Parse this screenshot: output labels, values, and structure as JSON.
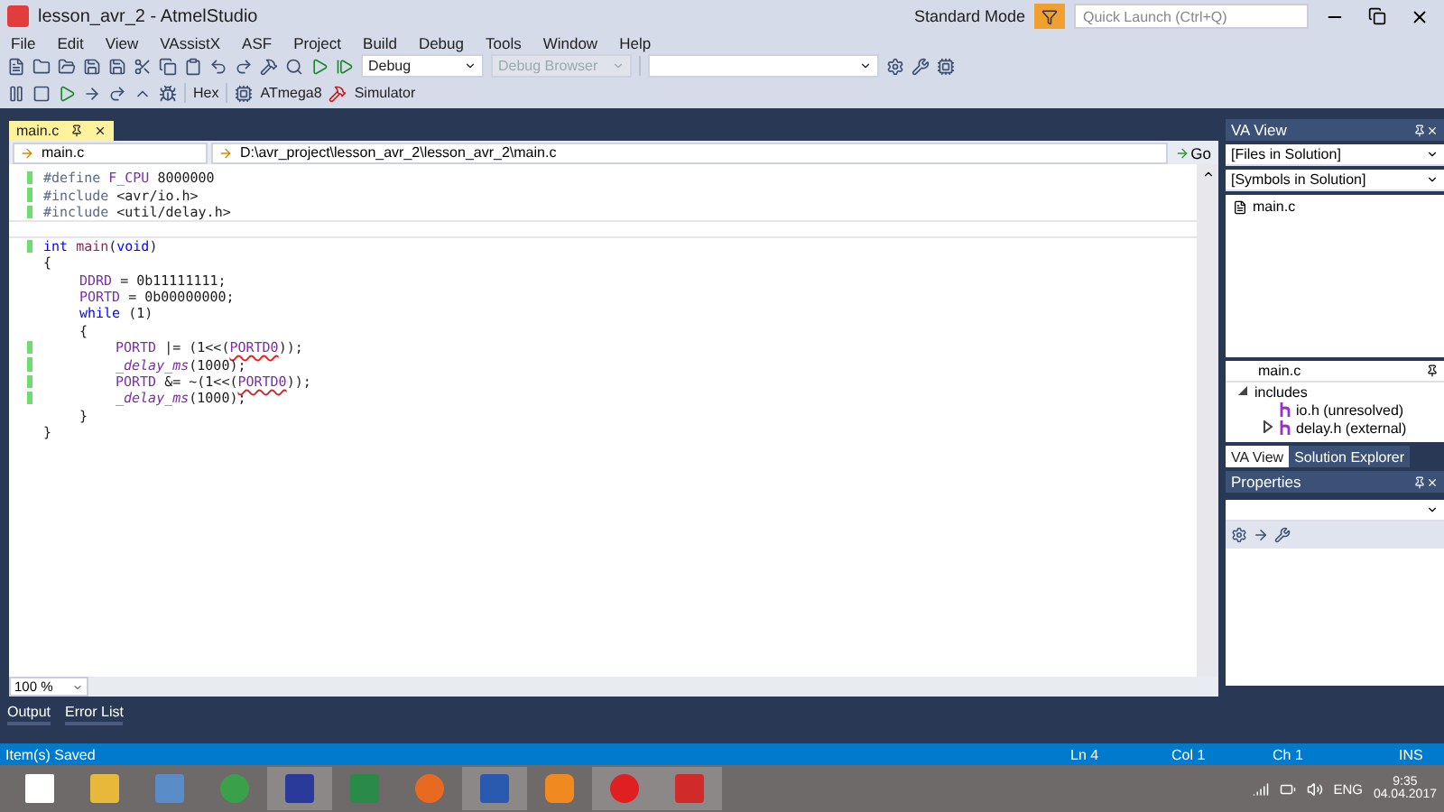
{
  "window": {
    "title": "lesson_avr_2 - AtmelStudio",
    "mode": "Standard Mode",
    "quick_launch": {
      "placeholder": "Quick Launch (Ctrl+Q)"
    }
  },
  "menu": [
    "File",
    "Edit",
    "View",
    "VAssistX",
    "ASF",
    "Project",
    "Build",
    "Debug",
    "Tools",
    "Window",
    "Help"
  ],
  "toolbar": {
    "configuration": "Debug",
    "browser": "Debug Browser",
    "hex": "Hex",
    "device": "ATmega8",
    "tool": "Simulator"
  },
  "document_tab": {
    "label": "main.c",
    "selected": true
  },
  "nav": {
    "scope": "main.c",
    "path": "D:\\avr_project\\lesson_avr_2\\lesson_avr_2\\main.c",
    "go": "Go"
  },
  "code": [
    {
      "changed": true,
      "current": false,
      "tokens": [
        {
          "kind": "pre",
          "text": "#define "
        },
        {
          "kind": "macro",
          "text": "F_CPU"
        },
        {
          "kind": "plain",
          "text": " 8000000"
        }
      ]
    },
    {
      "changed": true,
      "current": false,
      "tokens": [
        {
          "kind": "pre",
          "text": "#include "
        },
        {
          "kind": "plain",
          "text": "<avr/io.h>"
        }
      ]
    },
    {
      "changed": true,
      "current": false,
      "tokens": [
        {
          "kind": "pre",
          "text": "#include "
        },
        {
          "kind": "plain",
          "text": "<util/delay.h>"
        }
      ]
    },
    {
      "changed": false,
      "current": true
    },
    {
      "changed": true,
      "current": false,
      "tokens": [
        {
          "kind": "kw",
          "text": "int "
        },
        {
          "kind": "fn",
          "text": "main"
        },
        {
          "kind": "plain",
          "text": "("
        },
        {
          "kind": "kw",
          "text": "void"
        },
        {
          "kind": "plain",
          "text": ")"
        }
      ]
    },
    {
      "changed": false,
      "current": false,
      "tokens": [
        {
          "kind": "plain",
          "text": "{"
        }
      ],
      "children": [
        {
          "changed": false,
          "current": false,
          "tokens": [
            {
              "kind": "macro",
              "text": "DDRD"
            },
            {
              "kind": "plain",
              "text": " = 0b11111111;"
            }
          ]
        },
        {
          "changed": false,
          "current": false,
          "tokens": [
            {
              "kind": "macro",
              "text": "PORTD"
            },
            {
              "kind": "plain",
              "text": " = 0b00000000;"
            }
          ]
        },
        {
          "changed": false,
          "current": false,
          "tokens": [
            {
              "kind": "kw",
              "text": "while"
            },
            {
              "kind": "plain",
              "text": " (1)"
            }
          ]
        },
        {
          "changed": false,
          "current": false,
          "tokens": [
            {
              "kind": "plain",
              "text": "{"
            }
          ],
          "children": [
            {
              "changed": true,
              "current": false,
              "tokens": [
                {
                  "kind": "macro",
                  "text": "PORTD"
                },
                {
                  "kind": "plain",
                  "text": " |= (1<<("
                },
                {
                  "kind": "err",
                  "text": "PORTD0"
                },
                {
                  "kind": "plain",
                  "text": "));"
                }
              ]
            },
            {
              "changed": true,
              "current": false,
              "tokens": [
                {
                  "kind": "fnmacro",
                  "text": "_delay_ms"
                },
                {
                  "kind": "plain",
                  "text": "(1000);"
                }
              ]
            },
            {
              "changed": true,
              "current": false,
              "tokens": [
                {
                  "kind": "macro",
                  "text": "PORTD"
                },
                {
                  "kind": "plain",
                  "text": " &= ~(1<<("
                },
                {
                  "kind": "err",
                  "text": "PORTD0"
                },
                {
                  "kind": "plain",
                  "text": "));"
                }
              ]
            },
            {
              "changed": true,
              "current": false,
              "tokens": [
                {
                  "kind": "fnmacro",
                  "text": "_delay_ms"
                },
                {
                  "kind": "plain",
                  "text": "(1000);"
                }
              ]
            }
          ]
        },
        {
          "changed": false,
          "current": false,
          "tokens": [
            {
              "kind": "plain",
              "text": "}"
            }
          ]
        }
      ]
    },
    {
      "changed": false,
      "current": false,
      "tokens": [
        {
          "kind": "plain",
          "text": "}"
        }
      ]
    }
  ],
  "zoom": "100 %",
  "bottom_tabs": [
    {
      "label": "Output",
      "selected": false
    },
    {
      "label": "Error List",
      "selected": false
    }
  ],
  "va_view": {
    "title": "VA View",
    "files": "[Files in Solution]",
    "symbols": "[Symbols in Solution]",
    "items": [
      "main.c"
    ],
    "outline_file": "main.c",
    "outline": [
      {
        "label": "includes",
        "expanded": true,
        "children": [
          {
            "label": "io.h (unresolved)"
          },
          {
            "label": "delay.h (external)",
            "expanded": false
          }
        ]
      }
    ]
  },
  "panel_tabs": [
    {
      "label": "VA View",
      "selected": true
    },
    {
      "label": "Solution Explorer",
      "selected": false
    }
  ],
  "properties": {
    "title": "Properties"
  },
  "status": {
    "message": "Item(s) Saved",
    "line": "Ln 4",
    "col": "Col 1",
    "ch": "Ch 1",
    "mode": "INS"
  },
  "taskbar": {
    "language": "ENG",
    "time": "9:35",
    "date": "04.04.2017",
    "apps": [
      {
        "kind": "folder",
        "selected": false
      },
      {
        "kind": "calculator",
        "selected": false
      },
      {
        "kind": "browser",
        "selected": false
      },
      {
        "kind": "floppy",
        "selected": true
      },
      {
        "kind": "sheet",
        "selected": false
      },
      {
        "kind": "firefox",
        "selected": false
      },
      {
        "kind": "word",
        "selected": true
      },
      {
        "kind": "player",
        "selected": false
      },
      {
        "kind": "yandex",
        "selected": true
      },
      {
        "kind": "studio",
        "selected": true
      }
    ]
  }
}
